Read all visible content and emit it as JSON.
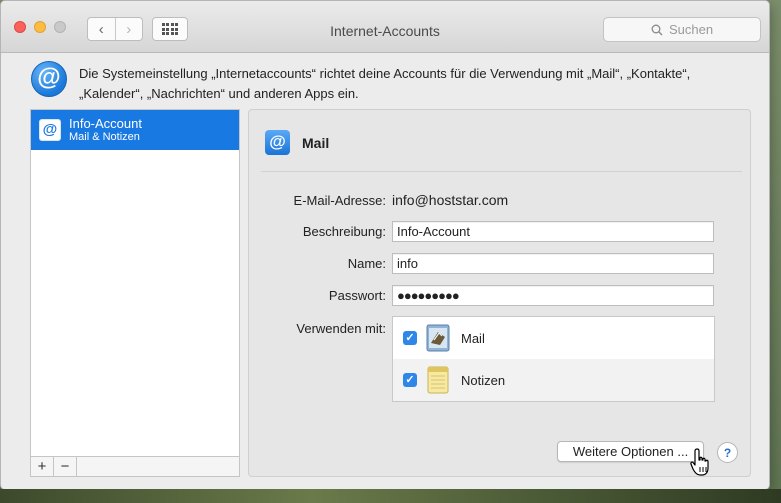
{
  "window": {
    "title": "Internet-Accounts"
  },
  "toolbar": {
    "back_label": "‹",
    "forward_label": "›",
    "search_placeholder": "Suchen"
  },
  "info": {
    "text": "Die Systemeinstellung „Internetaccounts“ richtet deine Accounts für die Verwendung mit „Mail“, „Kontakte“, „Kalender“, „Nachrichten“ und anderen Apps ein."
  },
  "icons": {
    "at_symbol": "@"
  },
  "sidebar": {
    "accounts": [
      {
        "name": "Info-Account",
        "sub": "Mail & Notizen",
        "selected": true
      }
    ],
    "add_label": "+",
    "remove_label": "−"
  },
  "panel": {
    "title": "Mail",
    "email_label": "E-Mail-Adresse:",
    "email_value": "info@hoststar.com",
    "description_label": "Beschreibung:",
    "description_value": "Info-Account",
    "name_label": "Name:",
    "name_value": "info",
    "password_label": "Passwort:",
    "password_value": "●●●●●●●●●",
    "use_with_label": "Verwenden mit:",
    "apps": [
      {
        "name": "Mail",
        "checked": true,
        "icon": "mail-app-icon"
      },
      {
        "name": "Notizen",
        "checked": true,
        "icon": "notes-app-icon"
      }
    ],
    "more_options_label": "Weitere Optionen ...",
    "help_label": "?"
  },
  "colors": {
    "accent": "#1979e2",
    "check": "#2f86e9"
  }
}
